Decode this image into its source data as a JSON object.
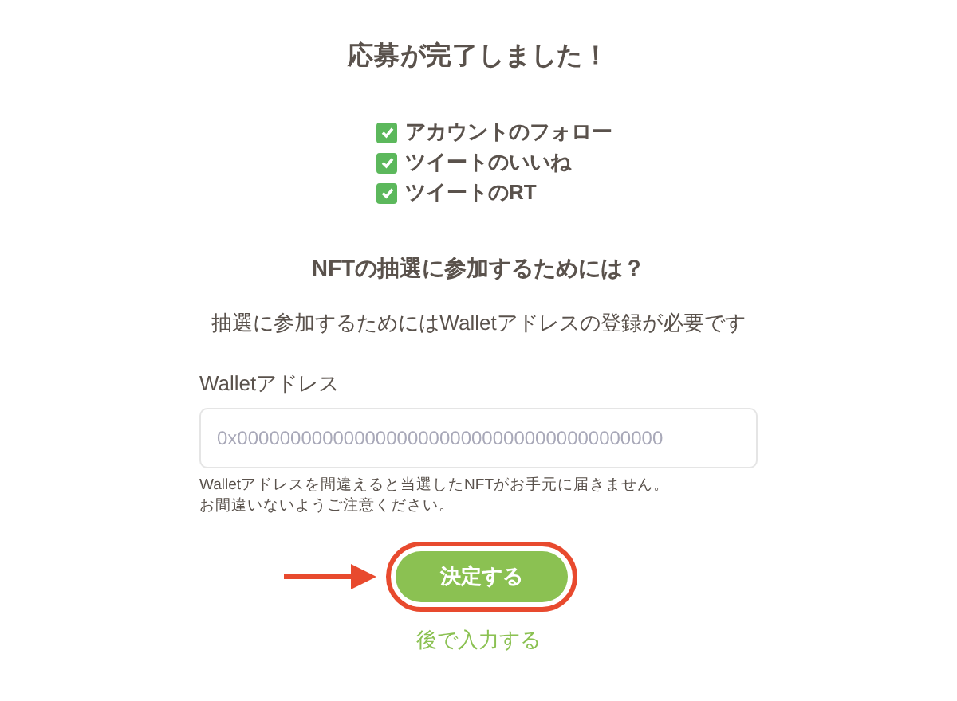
{
  "title": "応募が完了しました！",
  "tasks": [
    {
      "label": "アカウントのフォロー",
      "checked": true
    },
    {
      "label": "ツイートのいいね",
      "checked": true
    },
    {
      "label": "ツイートのRT",
      "checked": true
    }
  ],
  "heading": "NFTの抽選に参加するためには？",
  "description": "抽選に参加するためにはWalletアドレスの登録が必要です",
  "wallet_field": {
    "label": "Walletアドレス",
    "placeholder": "0x0000000000000000000000000000000000000000"
  },
  "notes": [
    "Walletアドレスを間違えると当選したNFTがお手元に届きません。",
    "お間違いないようご注意ください。"
  ],
  "submit_button": "決定する",
  "later_link": "後で入力する"
}
